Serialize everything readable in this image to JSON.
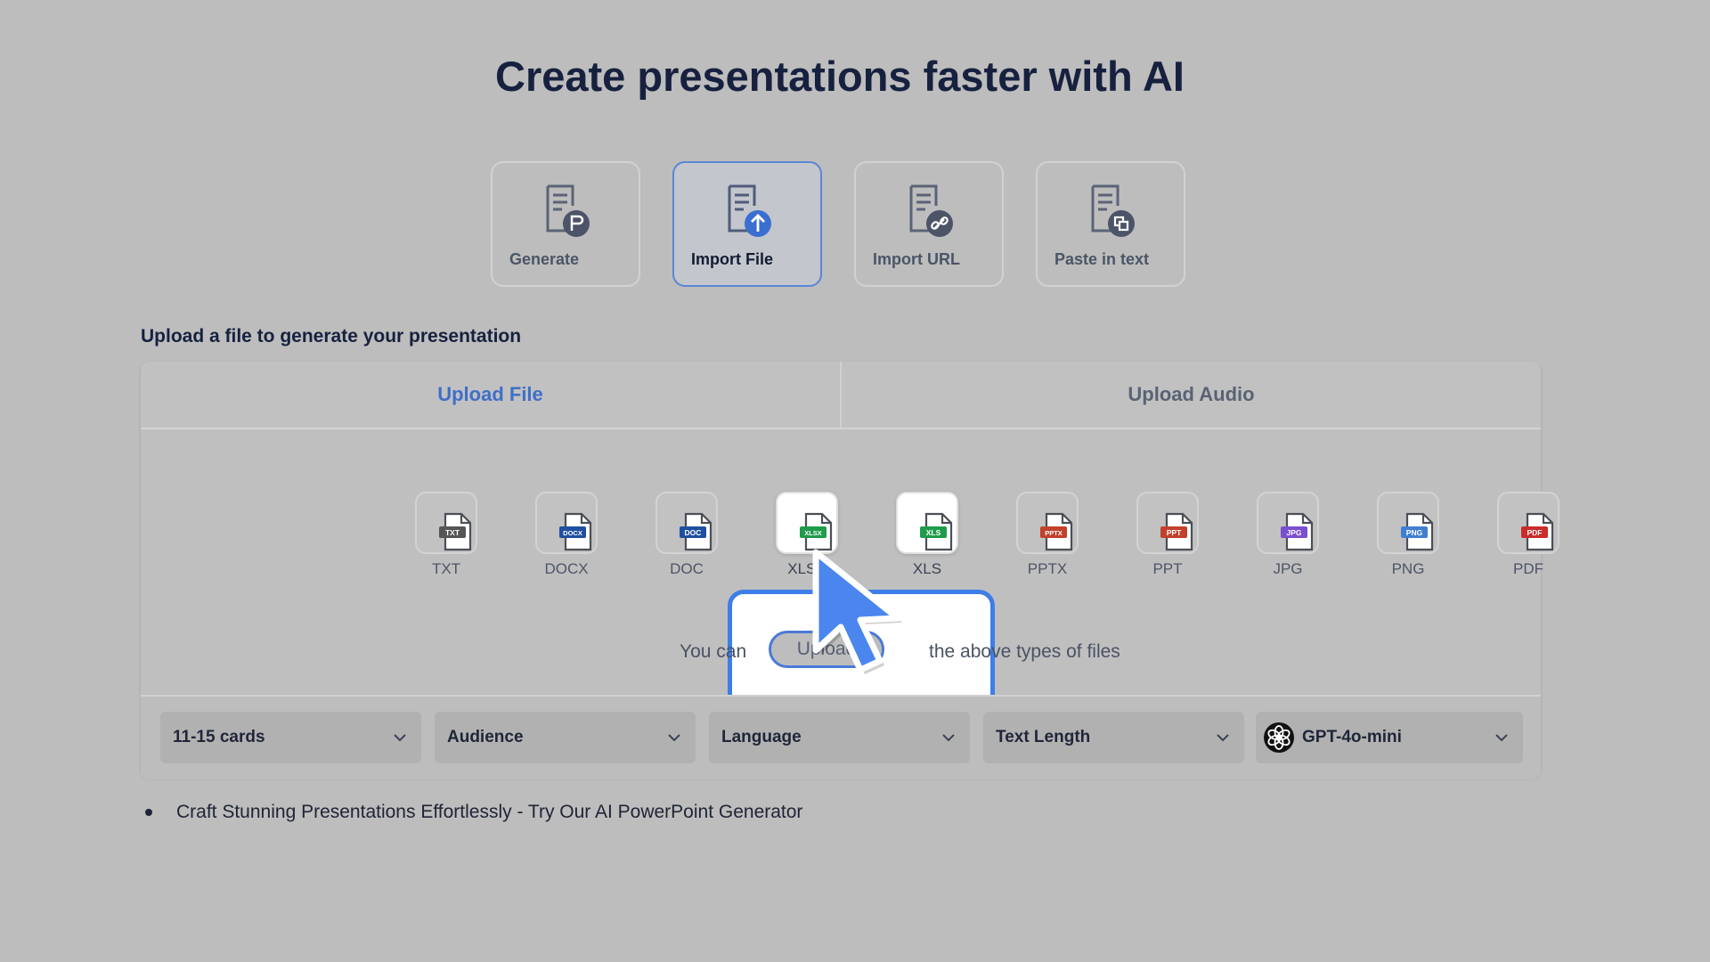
{
  "page_title": "Create presentations faster with AI",
  "modes": [
    {
      "label": "Generate",
      "icon": "document-presentation-icon",
      "active": false
    },
    {
      "label": "Import File",
      "icon": "document-upload-icon",
      "active": true
    },
    {
      "label": "Import URL",
      "icon": "document-link-icon",
      "active": false
    },
    {
      "label": "Paste in text",
      "icon": "document-paste-icon",
      "active": false
    }
  ],
  "section_label": "Upload a file to generate your presentation",
  "tabs": [
    {
      "label": "Upload File",
      "active": true
    },
    {
      "label": "Upload Audio",
      "active": false
    }
  ],
  "file_types": [
    {
      "label": "TXT",
      "badge": "TXT",
      "color": "#555555"
    },
    {
      "label": "DOCX",
      "badge": "DOCX",
      "color": "#1f4fa0"
    },
    {
      "label": "DOC",
      "badge": "DOC",
      "color": "#1f4fa0"
    },
    {
      "label": "XLSX",
      "badge": "XLSX",
      "color": "#1e9c4b"
    },
    {
      "label": "XLS",
      "badge": "XLS",
      "color": "#1e9c4b"
    },
    {
      "label": "PPTX",
      "badge": "PPTX",
      "color": "#c2412b"
    },
    {
      "label": "PPT",
      "badge": "PPT",
      "color": "#c2412b"
    },
    {
      "label": "JPG",
      "badge": "JPG",
      "color": "#7b4fd1"
    },
    {
      "label": "PNG",
      "badge": "PNG",
      "color": "#3f7fd0"
    },
    {
      "label": "PDF",
      "badge": "PDF",
      "color": "#cc2b2b"
    }
  ],
  "upload_note": {
    "prefix": "You can",
    "button_label": "Upload",
    "suffix": "the above types of files"
  },
  "controls": {
    "cards": "11-15 cards",
    "audience": "Audience",
    "language": "Language",
    "text_length": "Text Length",
    "model": "GPT-4o-mini"
  },
  "bullets": [
    "Craft Stunning Presentations Effortlessly - Try Our AI PowerPoint Generator"
  ],
  "colors": {
    "accent": "#3f6fc9",
    "highlight_border": "#3d7ee8",
    "cursor": "#4a86ee"
  }
}
